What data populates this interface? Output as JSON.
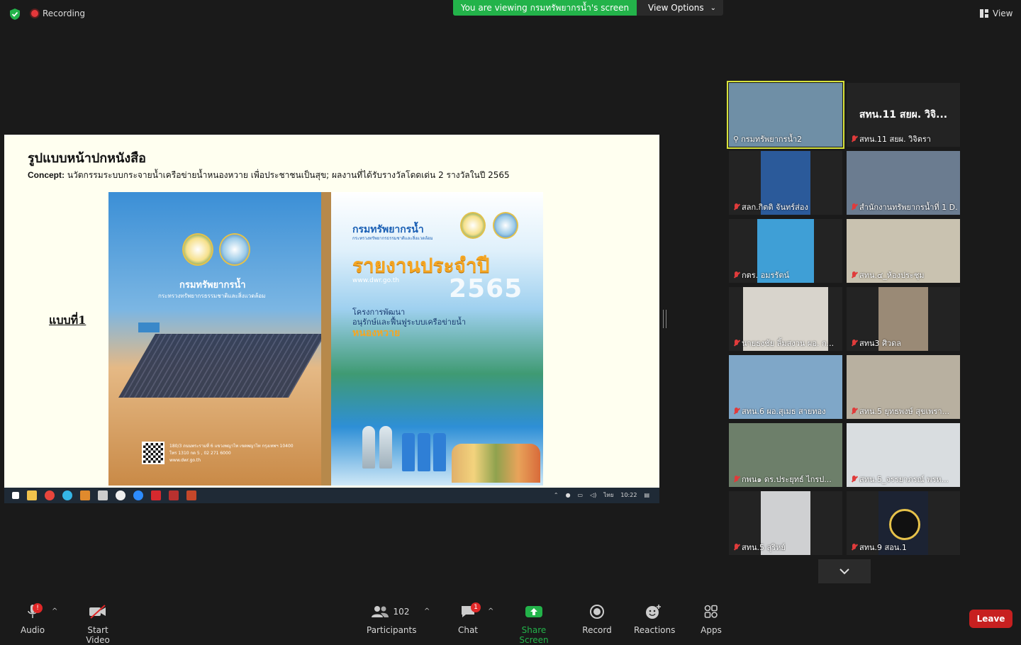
{
  "topbar": {
    "recording": "Recording",
    "viewing_banner": "You are viewing กรมทรัพยากรน้ำ's screen",
    "view_options": "View Options",
    "view": "View"
  },
  "slide": {
    "title": "รูปแบบหน้าปกหนังสือ",
    "concept_label": "Concept:",
    "concept_text": " นวัตกรรมระบบกระจายน้ำเครือข่ายน้ำหนองหวาย เพื่อประชาชนเป็นสุข; ผลงานที่ได้รับรางวัลโดดเด่น 2 รางวัลในปี 2565",
    "variant": "แบบที่1",
    "cover_left_org": "กรมทรัพยากรน้ำ",
    "cover_left_sub": "กระทรวงทรัพยากรธรรมชาติและสิ่งแวดล้อม",
    "cover_left_addr1": "180/3 ถนนพระรามที่ 6 แขวงพญาไท เขตพญาไท กรุงเทพฯ 10400",
    "cover_left_addr2": "โทร 1310 กด 5 , 02 271 6000",
    "cover_left_addr3": "www.dwr.go.th",
    "cover_right_org": "กรมทรัพยากรน้ำ",
    "cover_right_sub": "กระทรวงทรัพยากรธรรมชาติและสิ่งแวดล้อม",
    "cover_right_title": "รายงานประจำปี",
    "cover_right_year": "2565",
    "cover_right_web": "www.dwr.go.th",
    "cover_right_proj1": "โครงการพัฒนา",
    "cover_right_proj2": "อนุรักษ์และฟื้นฟูระบบเครือข่ายน้ำ",
    "cover_right_proj3": "หนองหวาย"
  },
  "taskbar": {
    "lang": "ไทย",
    "time": "10:22"
  },
  "gallery": [
    {
      "name": "กรมทรัพยากรน้ำ2",
      "muted": false,
      "video": "#6f8fa6",
      "active": true
    },
    {
      "name": "สทน.11 สยผ. วิจิตรา",
      "muted": true,
      "video": "",
      "bigname": "สทน.11 สยผ. วิจิ..."
    },
    {
      "name": "สลก.กิตติ จันทร์ส่อง",
      "muted": true,
      "video": "#2b5a9a"
    },
    {
      "name": "สำนักงานทรัพยากรน้ำที่ 1 D...",
      "muted": true,
      "video": "#6b7c90"
    },
    {
      "name": "กตร. อมรรัตน์",
      "muted": true,
      "video": "#3f9fd6"
    },
    {
      "name": "สทน.๔_ห้องประชุม",
      "muted": true,
      "video": "#c9c2b0"
    },
    {
      "name": "นายธงชัย ลิ้มสงวน ผอ. ก...",
      "muted": true,
      "video": "#d8d4cc"
    },
    {
      "name": "สทน3 ศิวดล",
      "muted": true,
      "video": "#9a8a76"
    },
    {
      "name": "สทน.6 ผอ.สุเมธ สายทอง",
      "muted": true,
      "video": "#7fa7c8"
    },
    {
      "name": "สทน.5 ยุทธพงษ์ สุขเพรา...",
      "muted": true,
      "video": "#b8b0a0"
    },
    {
      "name": "กพน๑ ดร.ประยุทธ์ ไกรป...",
      "muted": true,
      "video": "#6d7f6a"
    },
    {
      "name": "สทน.5_จรรยาภรณ์ พรห...",
      "muted": true,
      "video": "#d9dde0"
    },
    {
      "name": "สทน.5 สุริหย์",
      "muted": true,
      "video": "#cfd0d2"
    },
    {
      "name": "สทน.9 สอน.1",
      "muted": true,
      "video": "#1c2333"
    }
  ],
  "toolbar": {
    "audio": "Audio",
    "audio_badge": "!",
    "start_video": "Start Video",
    "participants": "Participants",
    "participants_count": "102",
    "chat": "Chat",
    "chat_badge": "1",
    "share_screen": "Share Screen",
    "record": "Record",
    "reactions": "Reactions",
    "apps": "Apps",
    "leave": "Leave"
  },
  "colors": {
    "accent_green": "#23b34a",
    "leave_red": "#c72020",
    "active_speaker": "#d8e33b"
  }
}
